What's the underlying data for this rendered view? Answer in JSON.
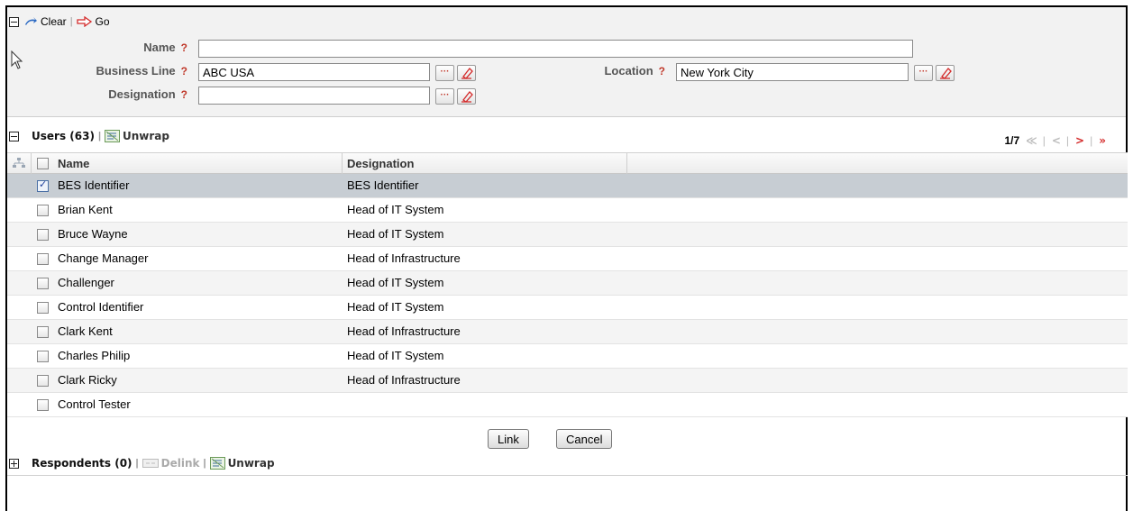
{
  "toolbar": {
    "clear_label": "Clear",
    "go_label": "Go"
  },
  "search": {
    "name_label": "Name",
    "name_value": "",
    "business_line_label": "Business Line",
    "business_line_value": "ABC USA",
    "location_label": "Location",
    "location_value": "New York City",
    "designation_label": "Designation",
    "designation_value": "",
    "help_mark": "?",
    "dots": "···"
  },
  "users": {
    "title": "Users (63)",
    "unwrap_label": "Unwrap",
    "pager_text": "1/7",
    "first_glyph": "≪",
    "prev_glyph": "<",
    "next_glyph": ">",
    "last_glyph": "»",
    "columns": {
      "name": "Name",
      "designation": "Designation"
    },
    "rows": [
      {
        "name": "BES Identifier",
        "designation": "BES Identifier",
        "checked": true
      },
      {
        "name": "Brian Kent",
        "designation": "Head of IT System",
        "checked": false
      },
      {
        "name": "Bruce Wayne",
        "designation": "Head of IT System",
        "checked": false
      },
      {
        "name": "Change Manager",
        "designation": "Head of Infrastructure",
        "checked": false
      },
      {
        "name": "Challenger",
        "designation": "Head of IT System",
        "checked": false
      },
      {
        "name": "Control Identifier",
        "designation": "Head of IT System",
        "checked": false
      },
      {
        "name": "Clark Kent",
        "designation": "Head of Infrastructure",
        "checked": false
      },
      {
        "name": "Charles Philip",
        "designation": "Head of IT System",
        "checked": false
      },
      {
        "name": "Clark Ricky",
        "designation": "Head of Infrastructure",
        "checked": false
      },
      {
        "name": "Control Tester",
        "designation": "",
        "checked": false
      }
    ]
  },
  "actions": {
    "link_label": "Link",
    "cancel_label": "Cancel"
  },
  "respondents": {
    "title": "Respondents (0)",
    "delink_label": "Delink",
    "unwrap_label": "Unwrap"
  },
  "colors": {
    "accent_red": "#c0392b",
    "selected_row": "#c7cdd3",
    "panel_bg": "#f2f2f2"
  }
}
